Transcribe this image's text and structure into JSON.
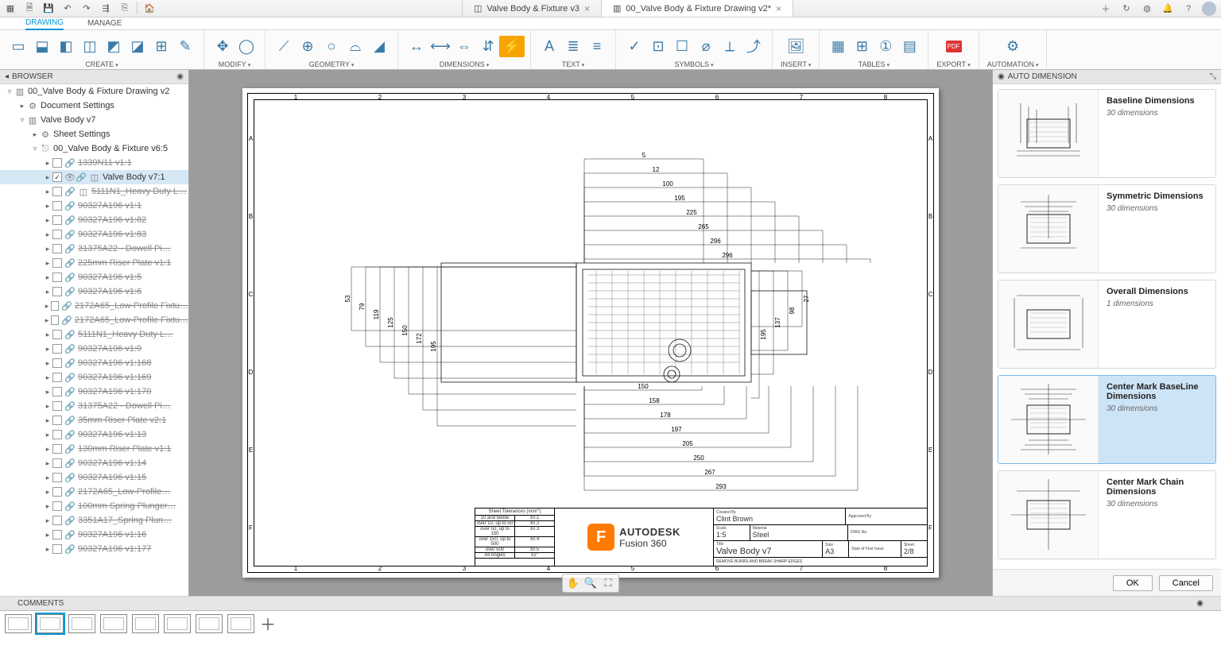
{
  "qat_icons": [
    "grid",
    "file",
    "save",
    "undo",
    "redo",
    "tree",
    "clone",
    "|",
    "home"
  ],
  "tabs": [
    {
      "icon": "cube",
      "label": "Valve Body & Fixture v3",
      "active": false,
      "dirty": false
    },
    {
      "icon": "sheet",
      "label": "00_Valve Body & Fixture Drawing v2*",
      "active": true,
      "dirty": true
    }
  ],
  "title_right_icons": [
    "plus",
    "ext",
    "globe",
    "bell",
    "help"
  ],
  "ribbon_tabs": [
    {
      "label": "DRAWING",
      "active": true
    },
    {
      "label": "MANAGE",
      "active": false
    }
  ],
  "ribbon_groups": [
    {
      "label": "CREATE",
      "drop": true,
      "icons": [
        "▭",
        "⬓",
        "◧",
        "◫",
        "◩",
        "◪",
        "⊞",
        "✎"
      ]
    },
    {
      "label": "MODIFY",
      "drop": true,
      "icons": [
        "✥",
        "◯"
      ]
    },
    {
      "label": "GEOMETRY",
      "drop": true,
      "icons": [
        "⟋",
        "⊕",
        "○",
        "⌓",
        "◢"
      ]
    },
    {
      "label": "DIMENSIONS",
      "drop": true,
      "icons": [
        "↔",
        "⟷",
        "⇔",
        "⇵",
        "⚡"
      ]
    },
    {
      "label": "TEXT",
      "drop": true,
      "icons": [
        "A",
        "≣",
        "≡"
      ]
    },
    {
      "label": "SYMBOLS",
      "drop": true,
      "icons": [
        "✓",
        "⊡",
        "☐",
        "⌀",
        "⟂",
        "⤴"
      ]
    },
    {
      "label": "INSERT",
      "drop": true,
      "icons": [
        "🖼"
      ]
    },
    {
      "label": "TABLES",
      "drop": true,
      "icons": [
        "▦",
        "⊞",
        "①",
        "▤"
      ]
    },
    {
      "label": "EXPORT",
      "drop": true,
      "icons": [
        "PDF"
      ]
    },
    {
      "label": "AUTOMATION",
      "drop": true,
      "icons": [
        "⚙"
      ]
    }
  ],
  "browser": {
    "title": "BROWSER",
    "tree": [
      {
        "depth": 0,
        "exp": "▿",
        "icon": "sheet",
        "label": "00_Valve Body & Fixture Drawing v2"
      },
      {
        "depth": 1,
        "exp": "▸",
        "icon": "gear",
        "label": "Document Settings"
      },
      {
        "depth": 1,
        "exp": "▿",
        "icon": "sheet",
        "label": "Valve Body v7"
      },
      {
        "depth": 2,
        "exp": "▸",
        "icon": "gear",
        "label": "Sheet Settings"
      },
      {
        "depth": 2,
        "exp": "▿",
        "icon": "link",
        "label": "00_Valve Body & Fixture v6:5"
      },
      {
        "depth": 3,
        "exp": "▸",
        "chk": false,
        "link": true,
        "label": "1339N11 v1:1",
        "strike": true
      },
      {
        "depth": 3,
        "exp": "▸",
        "chk": true,
        "eye": true,
        "link": true,
        "cube": true,
        "label": "Valve Body v7:1",
        "sel": true
      },
      {
        "depth": 3,
        "exp": "▸",
        "chk": false,
        "link": true,
        "cube": true,
        "label": "5111N1_Heavy Duty L…",
        "strike": true
      },
      {
        "depth": 3,
        "exp": "▸",
        "chk": false,
        "link": true,
        "label": "90327A196 v1:1",
        "strike": true
      },
      {
        "depth": 3,
        "exp": "▸",
        "chk": false,
        "link": true,
        "label": "90327A196 v1:82",
        "strike": true
      },
      {
        "depth": 3,
        "exp": "▸",
        "chk": false,
        "link": true,
        "label": "90327A196 v1:83",
        "strike": true
      },
      {
        "depth": 3,
        "exp": "▸",
        "chk": false,
        "link": true,
        "label": "31375A22 - Dowell Pi…",
        "strike": true
      },
      {
        "depth": 3,
        "exp": "▸",
        "chk": false,
        "link": true,
        "label": "225mm Riser Plate v1:1",
        "strike": true
      },
      {
        "depth": 3,
        "exp": "▸",
        "chk": false,
        "link": true,
        "label": "90327A196 v1:5",
        "strike": true
      },
      {
        "depth": 3,
        "exp": "▸",
        "chk": false,
        "link": true,
        "label": "90327A196 v1:6",
        "strike": true
      },
      {
        "depth": 3,
        "exp": "▸",
        "chk": false,
        "link": true,
        "label": "2172A65_Low-Profile Fixtu…",
        "strike": true
      },
      {
        "depth": 3,
        "exp": "▸",
        "chk": false,
        "link": true,
        "label": "2172A65_Low-Profile Fixtu…",
        "strike": true
      },
      {
        "depth": 3,
        "exp": "▸",
        "chk": false,
        "link": true,
        "label": "5111N1_Heavy Duty L…",
        "strike": true
      },
      {
        "depth": 3,
        "exp": "▸",
        "chk": false,
        "link": true,
        "label": "90327A196 v1:9",
        "strike": true
      },
      {
        "depth": 3,
        "exp": "▸",
        "chk": false,
        "link": true,
        "label": "90327A196 v1:168",
        "strike": true
      },
      {
        "depth": 3,
        "exp": "▸",
        "chk": false,
        "link": true,
        "label": "90327A196 v1:169",
        "strike": true
      },
      {
        "depth": 3,
        "exp": "▸",
        "chk": false,
        "link": true,
        "label": "90327A196 v1:170",
        "strike": true
      },
      {
        "depth": 3,
        "exp": "▸",
        "chk": false,
        "link": true,
        "label": "31375A22 - Dowell Pi…",
        "strike": true
      },
      {
        "depth": 3,
        "exp": "▸",
        "chk": false,
        "link": true,
        "label": "35mm Riser Plate v2:1",
        "strike": true
      },
      {
        "depth": 3,
        "exp": "▸",
        "chk": false,
        "link": true,
        "label": "90327A196 v1:13",
        "strike": true
      },
      {
        "depth": 3,
        "exp": "▸",
        "chk": false,
        "link": true,
        "label": "130mm Riser Plate v1:1",
        "strike": true
      },
      {
        "depth": 3,
        "exp": "▸",
        "chk": false,
        "link": true,
        "label": "90327A196 v1:14",
        "strike": true
      },
      {
        "depth": 3,
        "exp": "▸",
        "chk": false,
        "link": true,
        "label": "90327A196 v1:15",
        "strike": true
      },
      {
        "depth": 3,
        "exp": "▸",
        "chk": false,
        "link": true,
        "label": "2172A65_Low-Profile…",
        "strike": true
      },
      {
        "depth": 3,
        "exp": "▸",
        "chk": false,
        "link": true,
        "label": "100mm Spring Plunger…",
        "strike": true
      },
      {
        "depth": 3,
        "exp": "▸",
        "chk": false,
        "link": true,
        "label": "3351A17_Spring Plun…",
        "strike": true
      },
      {
        "depth": 3,
        "exp": "▸",
        "chk": false,
        "link": true,
        "label": "90327A196 v1:16",
        "strike": true
      },
      {
        "depth": 3,
        "exp": "▸",
        "chk": false,
        "link": true,
        "label": "90327A196 v1:177",
        "strike": true
      }
    ]
  },
  "ruler_cols": [
    "1",
    "2",
    "3",
    "4",
    "5",
    "6",
    "7",
    "8"
  ],
  "ruler_rows": [
    "A",
    "B",
    "C",
    "D",
    "E",
    "F"
  ],
  "dims_top": [
    "296",
    "296",
    "265",
    "225",
    "195",
    "100",
    "12",
    "5"
  ],
  "dims_bottom": [
    "150",
    "158",
    "178",
    "197",
    "205",
    "250",
    "267",
    "293"
  ],
  "dims_left": [
    "195",
    "172",
    "150",
    "125",
    "119",
    "79",
    "53"
  ],
  "dims_right": [
    "195",
    "137",
    "98",
    "27"
  ],
  "tolerances": {
    "title": "Sheet Tolerances (mm/°)",
    "rows": [
      {
        "range": "10 and below",
        "tol": "±0.1"
      },
      {
        "range": "over 10, up to 50",
        "tol": "±0.2"
      },
      {
        "range": "over 50, up to 150",
        "tol": "±0.3"
      },
      {
        "range": "over 150, up to 500",
        "tol": "±0.4"
      },
      {
        "range": "over 500",
        "tol": "±0.5"
      },
      {
        "range": "All Angles",
        "tol": "±2°"
      }
    ]
  },
  "logo": {
    "brand": "AUTODESK",
    "product": "Fusion 360",
    "mark": "F"
  },
  "titleblock": {
    "created_by_lbl": "Created By",
    "created_by": "Clint Brown",
    "approved_by_lbl": "Approved By",
    "approved_by": "",
    "scale_lbl": "Scale",
    "scale": "1:5",
    "material_lbl": "Material",
    "material": "Steel",
    "dwg_lbl": "DWG No.",
    "dwg": "",
    "title_lbl": "Title",
    "title": "Valve Body v7",
    "note": "REMOVE BURRS AND BREAK SHARP EDGES",
    "size_lbl": "Size",
    "size": "A3",
    "date_lbl": "Date of First Issue",
    "date": "",
    "sheet_lbl": "Sheet",
    "sheet": "2/8"
  },
  "autodim": {
    "title": "AUTO DIMENSION",
    "options": [
      {
        "title": "Baseline Dimensions",
        "sub": "30 dimensions",
        "sel": false
      },
      {
        "title": "Symmetric Dimensions",
        "sub": "30 dimensions",
        "sel": false
      },
      {
        "title": "Overall Dimensions",
        "sub": "1 dimensions",
        "sel": false
      },
      {
        "title": "Center Mark BaseLine Dimensions",
        "sub": "30 dimensions",
        "sel": true
      },
      {
        "title": "Center Mark Chain Dimensions",
        "sub": "30 dimensions",
        "sel": false
      }
    ],
    "ok": "OK",
    "cancel": "Cancel"
  },
  "comments_title": "COMMENTS",
  "sheet_count": 8,
  "active_sheet": 1
}
